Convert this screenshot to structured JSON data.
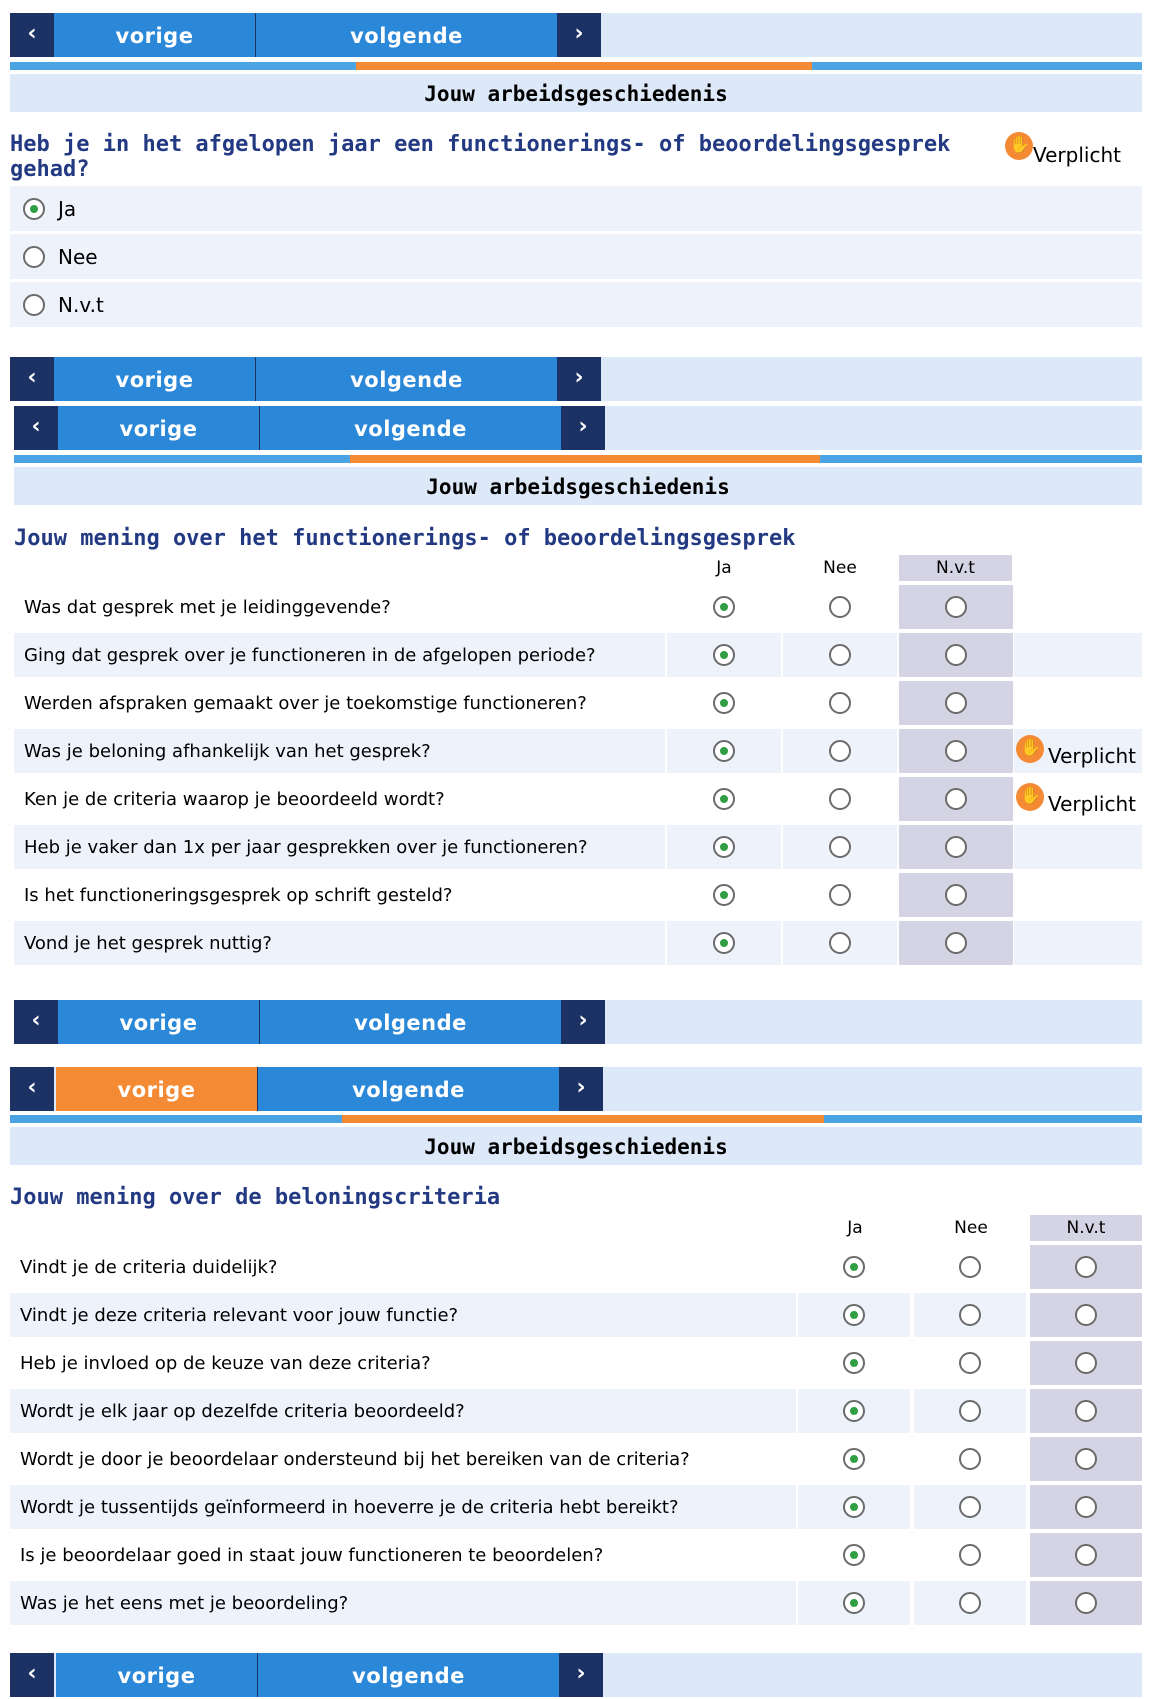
{
  "nav": {
    "prev_label": "vorige",
    "next_label": "volgende",
    "prev_icon": "chevron-left-icon",
    "next_icon": "chevron-right-icon"
  },
  "colors": {
    "nav_blue": "#2b88d8",
    "nav_dark": "#1c3264",
    "accent_orange": "#f58a34",
    "header_bg": "#dde8f8",
    "question_color": "#233a83"
  },
  "section_title": "Jouw arbeidsgeschiedenis",
  "required_label": "Verplicht",
  "block1": {
    "question": "Heb je in het afgelopen jaar een functionerings- of beoordelingsgesprek gehad?",
    "options": [
      "Ja",
      "Nee",
      "N.v.t"
    ],
    "selected": "Ja"
  },
  "block2": {
    "title": "Jouw mening over het functionerings- of beoordelingsgesprek",
    "columns": [
      "Ja",
      "Nee",
      "N.v.t"
    ],
    "rows": [
      "Was dat gesprek met je leidinggevende?",
      "Ging dat gesprek over je functioneren in de afgelopen periode?",
      "Werden afspraken gemaakt over je toekomstige functioneren?",
      "Was je beloning afhankelijk van het gesprek?",
      "Ken je de criteria waarop je beoordeeld wordt?",
      "Heb je vaker dan 1x per jaar gesprekken over je functioneren?",
      "Is het functioneringsgesprek op schrift gesteld?",
      "Vond je het gesprek nuttig?"
    ],
    "selected": "Ja"
  },
  "block3": {
    "title": "Jouw mening over de beloningscriteria",
    "columns": [
      "Ja",
      "Nee",
      "N.v.t"
    ],
    "rows": [
      "Vindt je de criteria duidelijk?",
      "Vindt je deze criteria relevant voor jouw functie?",
      "Heb je invloed op de keuze van deze criteria?",
      "Wordt je elk jaar op dezelfde criteria beoordeeld?",
      "Wordt je door je beoordelaar ondersteund bij het bereiken van de criteria?",
      "Wordt je tussentijds geïnformeerd in hoeverre je de criteria hebt bereikt?",
      "Is je beoordelaar goed in staat jouw functioneren te beoordelen?",
      "Was je het eens met je beoordeling?"
    ],
    "selected": "Ja"
  }
}
